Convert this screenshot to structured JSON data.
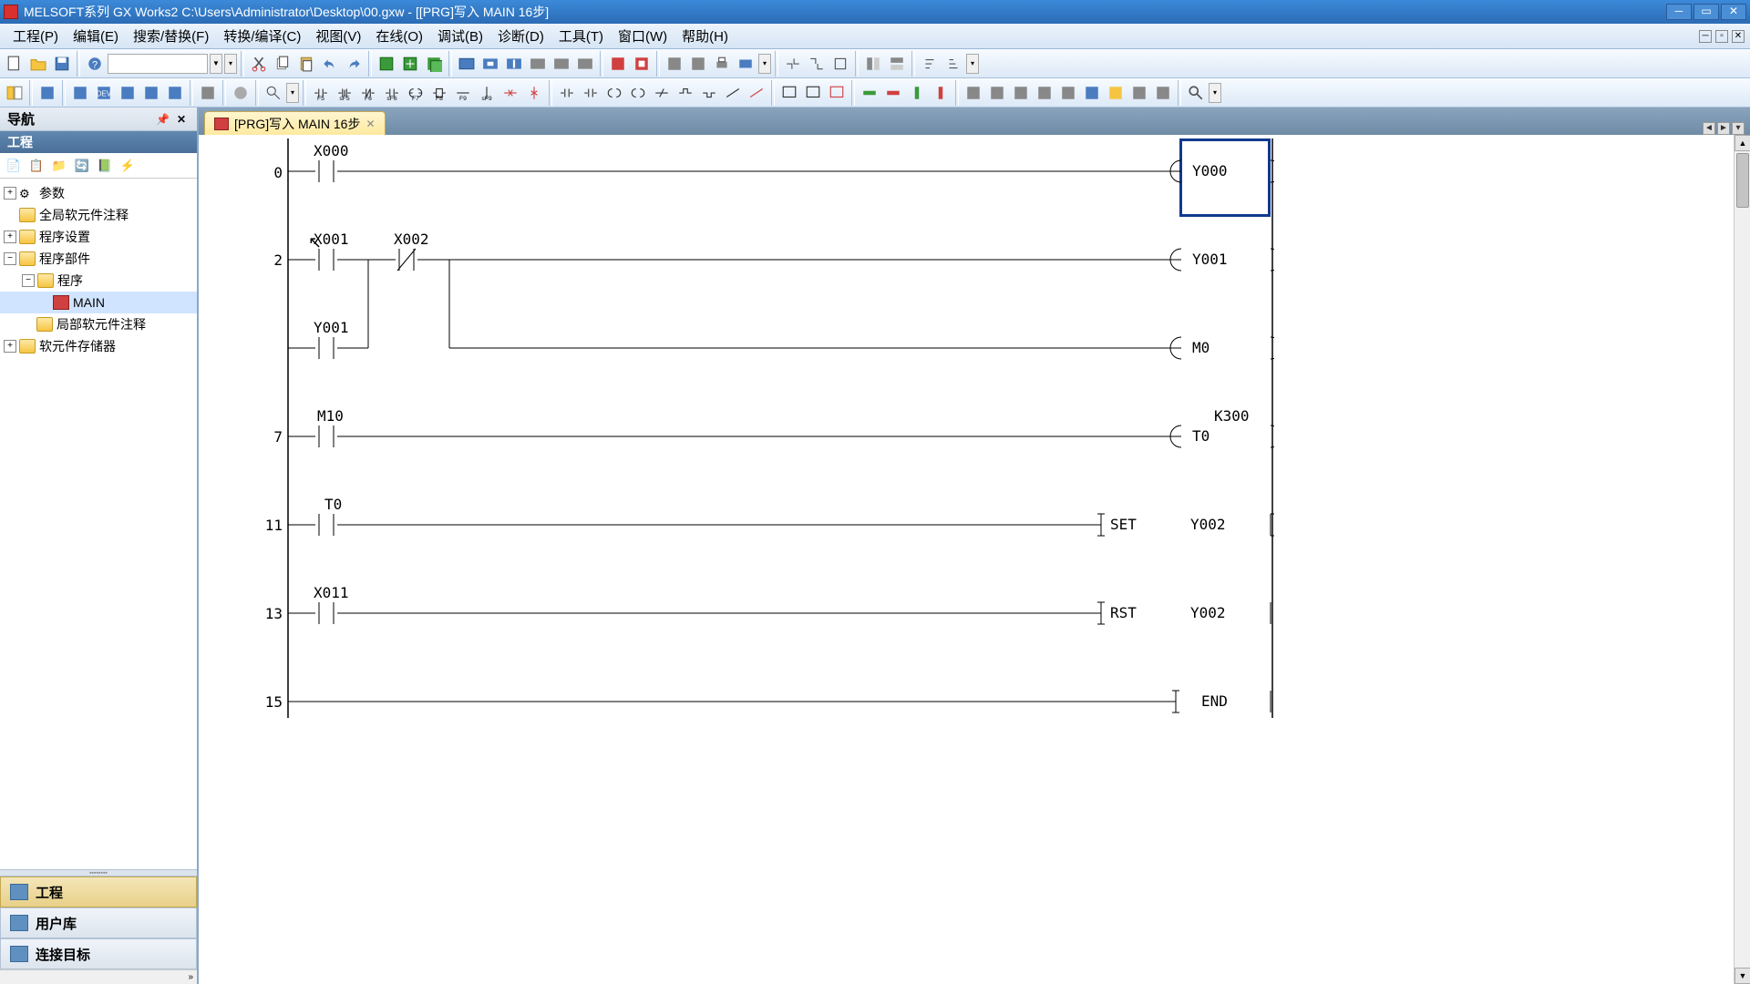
{
  "titlebar": {
    "title": "MELSOFT系列 GX Works2 C:\\Users\\Administrator\\Desktop\\00.gxw - [[PRG]写入 MAIN 16步]"
  },
  "menu": {
    "project": "工程(P)",
    "edit": "编辑(E)",
    "search": "搜索/替换(F)",
    "convert": "转换/编译(C)",
    "view": "视图(V)",
    "online": "在线(O)",
    "debug": "调试(B)",
    "diagnose": "诊断(D)",
    "tool": "工具(T)",
    "window": "窗口(W)",
    "help": "帮助(H)"
  },
  "nav": {
    "header": "导航",
    "sub": "工程",
    "tree": {
      "params": "参数",
      "global": "全局软元件注释",
      "prog_settings": "程序设置",
      "prog_parts": "程序部件",
      "program": "程序",
      "main": "MAIN",
      "local": "局部软元件注释",
      "device_mem": "软元件存储器"
    },
    "tabs": {
      "project": "工程",
      "userlib": "用户库",
      "conn": "连接目标"
    }
  },
  "doc_tab": {
    "label": "[PRG]写入 MAIN 16步"
  },
  "ladder": {
    "steps": [
      "0",
      "2",
      "7",
      "11",
      "13",
      "15"
    ],
    "x000": "X000",
    "x001": "X001",
    "x002": "X002",
    "x011": "X011",
    "y000": "Y000",
    "y001": "Y001",
    "y001b": "Y001",
    "m0": "M0",
    "m10": "M10",
    "t0": "T0",
    "t0b": "T0",
    "k300": "K300",
    "set": "SET",
    "rst": "RST",
    "y002a": "Y002",
    "y002b": "Y002",
    "end": "END"
  }
}
